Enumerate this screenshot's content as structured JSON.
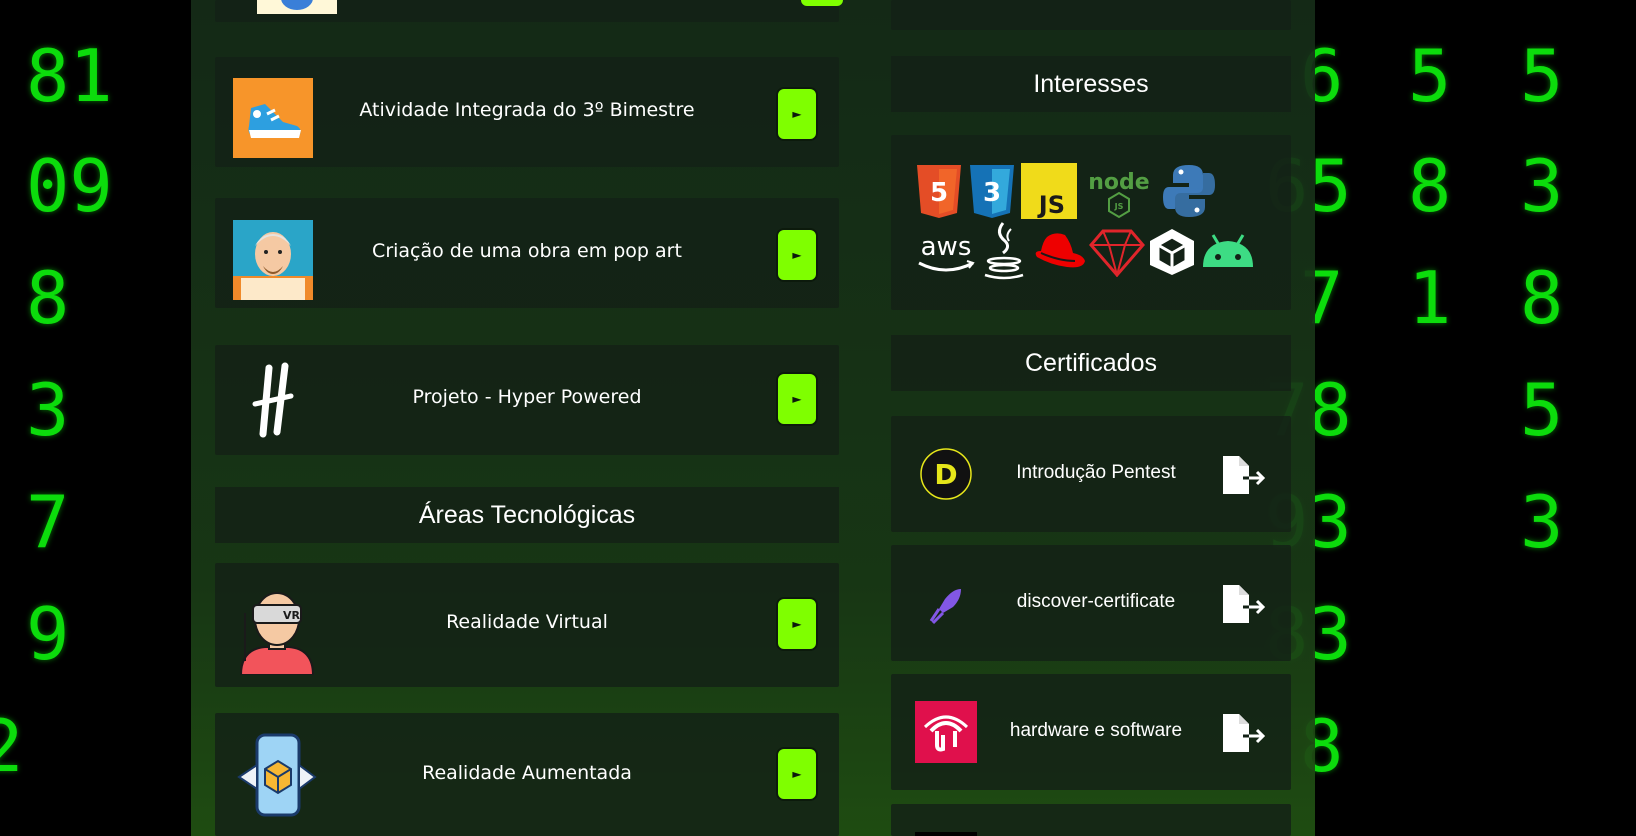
{
  "background": {
    "left_columns": [
      "81",
      "09",
      "8",
      "3",
      "7",
      "9",
      "2"
    ],
    "right_col1": [
      "6",
      "65",
      "7",
      "78",
      "93",
      "83",
      "8"
    ],
    "right_col2": [
      "5",
      "8",
      "1",
      "",
      "",
      "",
      ""
    ],
    "right_col3": [
      "5",
      "3",
      "8",
      "5",
      "3",
      "",
      ""
    ]
  },
  "projects": [
    {
      "title": "Atividade Integrada do 3º Bimestre",
      "button": "►",
      "icon": "sneaker-icon"
    },
    {
      "title": "Criação de uma obra em pop art",
      "button": "►",
      "icon": "shakespeare-icon"
    },
    {
      "title": "Projeto - Hyper Powered",
      "button": "►",
      "icon": "hyper-logo-icon"
    }
  ],
  "areas": {
    "header": "Áreas Tecnológicas",
    "items": [
      {
        "title": "Realidade Virtual",
        "button": "►",
        "icon": "vr-headset-icon"
      },
      {
        "title": "Realidade Aumentada",
        "button": "►",
        "icon": "augmented-reality-icon"
      }
    ]
  },
  "interests": {
    "header": "Interesses",
    "icons": [
      "html5-icon",
      "css3-icon",
      "javascript-icon",
      "nodejs-icon",
      "python-icon",
      "aws-icon",
      "java-icon",
      "redhat-icon",
      "ruby-icon",
      "unity-icon",
      "android-icon"
    ],
    "labels": {
      "html": "5",
      "css": "3",
      "js": "JS",
      "node": "node",
      "node_sub": "JS",
      "aws": "aws"
    }
  },
  "certificates": {
    "header": "Certificados",
    "items": [
      {
        "label": "Introdução Pentest",
        "icon": "dio-logo-icon",
        "logo_text": "D"
      },
      {
        "label": "discover-certificate",
        "icon": "rocketseat-icon"
      },
      {
        "label": "hardware e software",
        "icon": "bradesco-icon"
      }
    ]
  },
  "colors": {
    "accent": "#7fff00",
    "matrix": "#0cdc0c",
    "card": "#132116"
  }
}
